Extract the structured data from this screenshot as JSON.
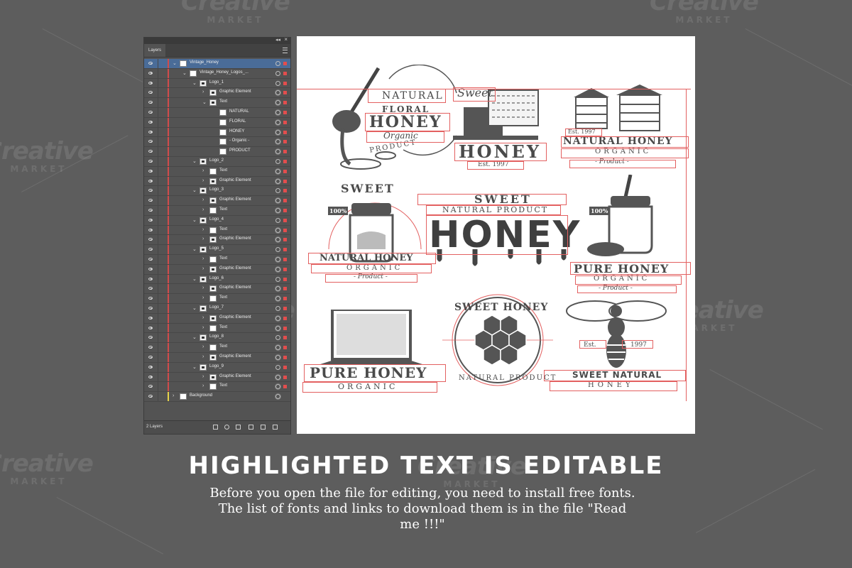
{
  "watermark": {
    "brand": "Creative",
    "sub": "MARKET"
  },
  "layers_panel": {
    "tab_label": "Layers",
    "footer_text": "2 Layers",
    "rows": [
      {
        "label": "Vintage_Honey"
      },
      {
        "label": "Vintage_Honey_Logos_..."
      },
      {
        "label": "Logo_1"
      },
      {
        "label": "Graphic Element"
      },
      {
        "label": "Text"
      },
      {
        "label": "NATURAL"
      },
      {
        "label": "FLORAL"
      },
      {
        "label": "HONEY"
      },
      {
        "label": "- Organic -"
      },
      {
        "label": "PRODUCT"
      },
      {
        "label": "Logo_2"
      },
      {
        "label": "Text"
      },
      {
        "label": "Graphic Element"
      },
      {
        "label": "Logo_3"
      },
      {
        "label": "Graphic Element"
      },
      {
        "label": "Text"
      },
      {
        "label": "Logo_4"
      },
      {
        "label": "Text"
      },
      {
        "label": "Graphic Element"
      },
      {
        "label": "Logo_5"
      },
      {
        "label": "Text"
      },
      {
        "label": "Graphic Element"
      },
      {
        "label": "Logo_6"
      },
      {
        "label": "Graphic Element"
      },
      {
        "label": "Text"
      },
      {
        "label": "Logo_7"
      },
      {
        "label": "Graphic Element"
      },
      {
        "label": "Text"
      },
      {
        "label": "Logo_8"
      },
      {
        "label": "Text"
      },
      {
        "label": "Graphic Element"
      },
      {
        "label": "Logo_9"
      },
      {
        "label": "Graphic Element"
      },
      {
        "label": "Text"
      },
      {
        "label": "Background"
      }
    ]
  },
  "artboard": {
    "logo1": {
      "top": "NATURAL",
      "mid": "FLORAL",
      "main": "HONEY",
      "script": "Organic",
      "bottom": "PRODUCT"
    },
    "logo2": {
      "script": "Sweet",
      "main": "HONEY",
      "est": "Est. 1997"
    },
    "logo3": {
      "est": "Est. 1997",
      "main": "NATURAL HONEY",
      "sub": "ORGANIC",
      "tag": "- Product -"
    },
    "logo4": {
      "top": "SWEET",
      "badge": "100%",
      "main": "NATURAL HONEY",
      "sub": "ORGANIC",
      "tag": "- Product -"
    },
    "logo5": {
      "top": "SWEET",
      "sub": "NATURAL PRODUCT",
      "main": "HONEY"
    },
    "logo6": {
      "badge": "100%",
      "main": "PURE HONEY",
      "sub": "ORGANIC",
      "tag": "- Product -"
    },
    "logo7": {
      "main": "PURE HONEY",
      "sub": "ORGANIC"
    },
    "logo8": {
      "top": "SWEET HONEY",
      "bottom": "NATURAL PRODUCT"
    },
    "logo9": {
      "est": "Est.",
      "year": "1997",
      "main": "SWEET NATURAL",
      "sub": "HONEY"
    }
  },
  "headline": "HIGHLIGHTED TEXT IS EDITABLE",
  "subtext": "Before you open the file for editing, you need to install free fonts. The list of fonts and links to download them is in the file \"Read me !!!\""
}
